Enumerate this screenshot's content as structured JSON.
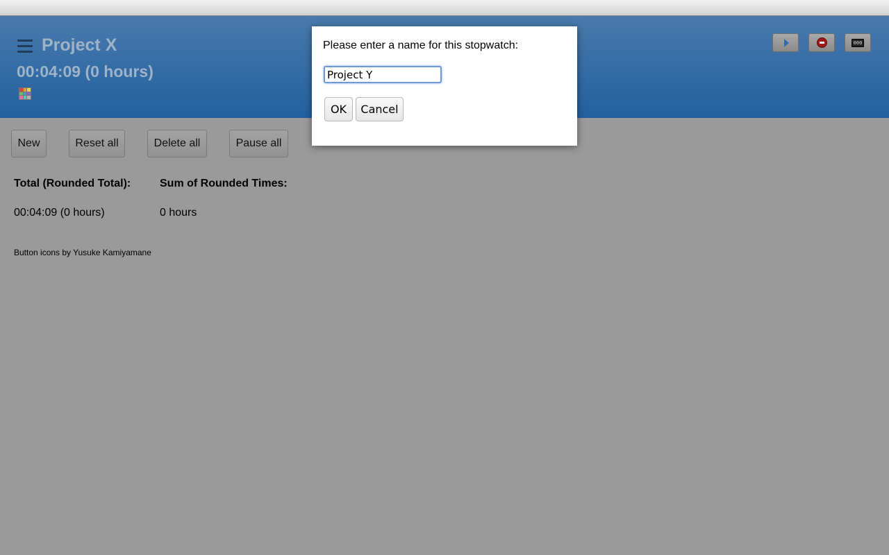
{
  "header": {
    "project_title": "Project X",
    "project_time": "00:04:09 (0 hours)",
    "buttons": {
      "start": "play-icon",
      "stop": "stop-icon",
      "counter": "000"
    }
  },
  "toolbar": {
    "new_label": "New",
    "reset_all_label": "Reset all",
    "delete_all_label": "Delete all",
    "pause_all_label": "Pause all"
  },
  "totals": {
    "total_label": "Total (Rounded Total):",
    "sum_label": "Sum of Rounded Times:",
    "total_value": "00:04:09 (0 hours)",
    "sum_value": "0 hours"
  },
  "footer": {
    "credit": "Button icons by Yusuke Kamiyamane"
  },
  "dialog": {
    "message": "Please enter a name for this stopwatch:",
    "input_value": "Project Y",
    "ok_label": "OK",
    "cancel_label": "Cancel"
  },
  "colors": {
    "header_top": "#4a7aab",
    "header_bottom": "#2260a0",
    "overlay_gray": "#9a9a9a",
    "palette": [
      "#d34a4a",
      "#e59a3b",
      "#e8d54a",
      "#6cbf5b",
      "#4a9bd1",
      "#8a64c7",
      "#e26fa8",
      "#5bc2b8",
      "#b0b0b0"
    ]
  }
}
